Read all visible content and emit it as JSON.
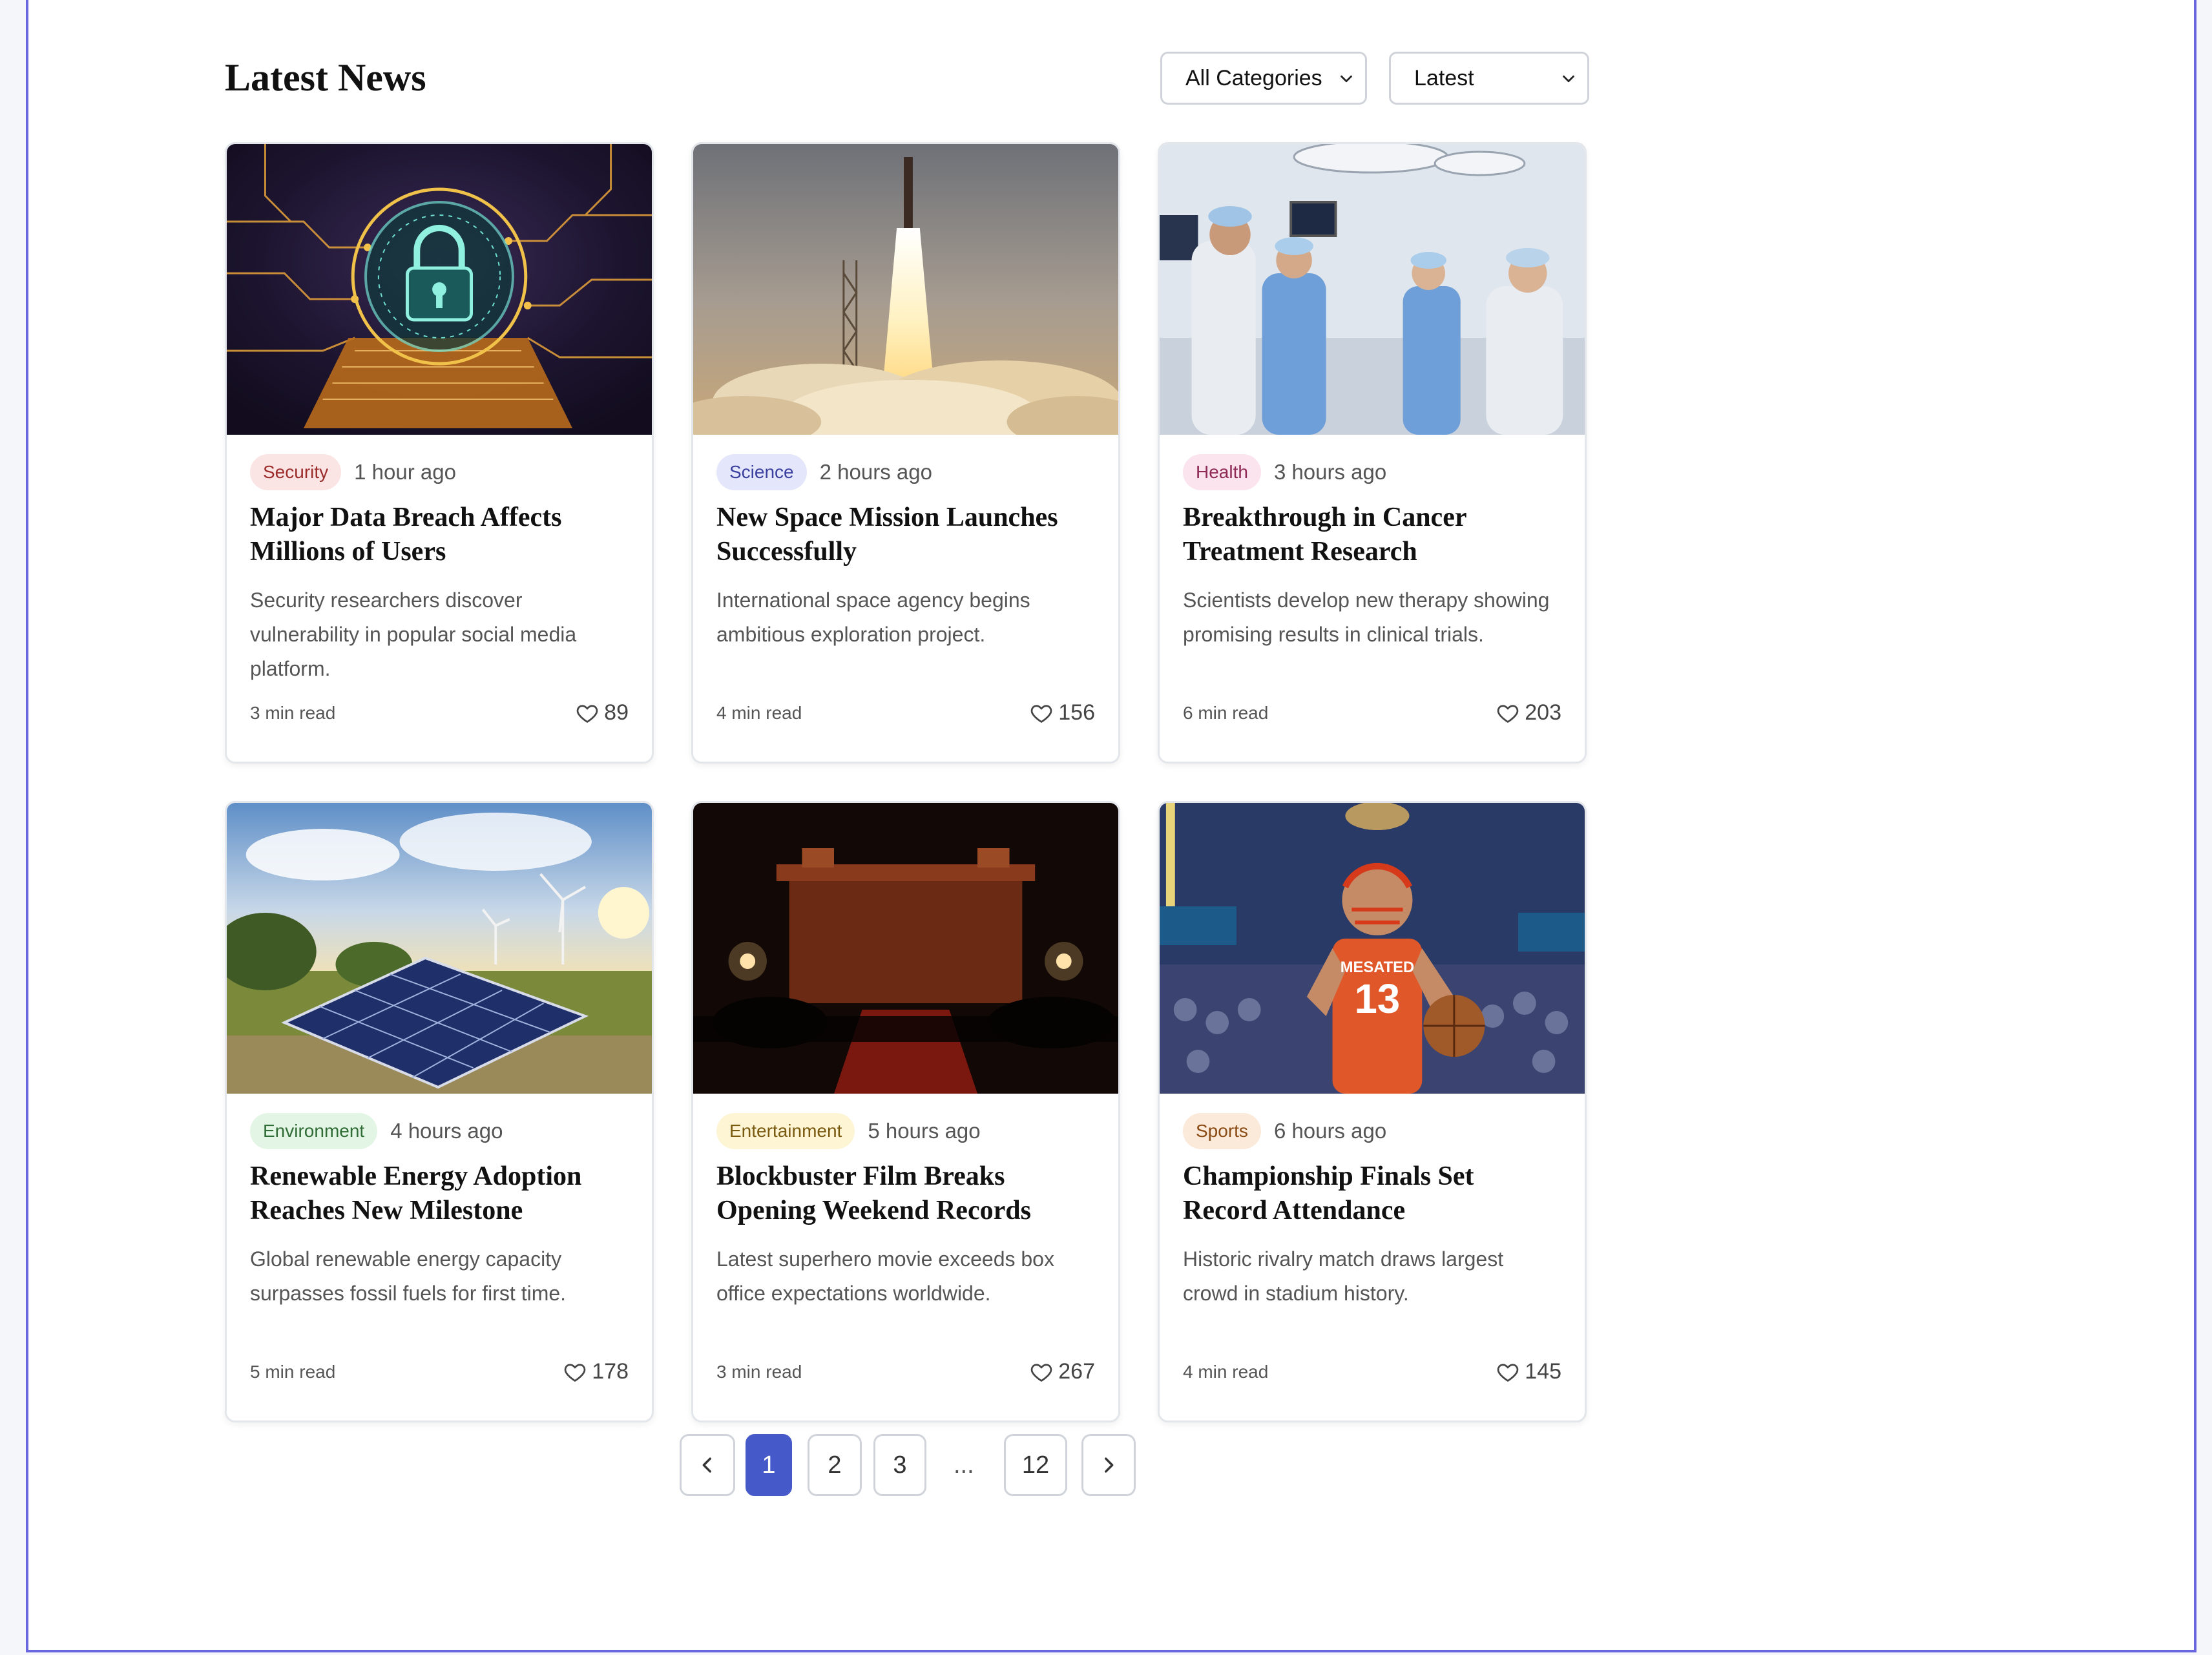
{
  "header": {
    "title": "Latest News",
    "category_select": {
      "value": "All Categories",
      "icon": "chevron-down-icon"
    },
    "sort_select": {
      "value": "Latest",
      "icon": "chevron-down-icon"
    }
  },
  "articles": [
    {
      "category": "Security",
      "badge_bg": "#fbe4e4",
      "badge_fg": "#9b2c2c",
      "time": "1 hour ago",
      "title": "Major Data Breach Affects Millions of Users",
      "excerpt": "Security researchers discover vulnerability in popular social media platform.",
      "read_time": "3 min read",
      "likes": "89"
    },
    {
      "category": "Science",
      "badge_bg": "#e4e6fb",
      "badge_fg": "#3a3f9e",
      "time": "2 hours ago",
      "title": "New Space Mission Launches Successfully",
      "excerpt": "International space agency begins ambitious exploration project.",
      "read_time": "4 min read",
      "likes": "156"
    },
    {
      "category": "Health",
      "badge_bg": "#fbe4ee",
      "badge_fg": "#8e2a55",
      "time": "3 hours ago",
      "title": "Breakthrough in Cancer Treatment Research",
      "excerpt": "Scientists develop new therapy showing promising results in clinical trials.",
      "read_time": "6 min read",
      "likes": "203"
    },
    {
      "category": "Environment",
      "badge_bg": "#e3f5e4",
      "badge_fg": "#2e6b35",
      "time": "4 hours ago",
      "title": "Renewable Energy Adoption Reaches New Milestone",
      "excerpt": "Global renewable energy capacity surpasses fossil fuels for first time.",
      "read_time": "5 min read",
      "likes": "178"
    },
    {
      "category": "Entertainment",
      "badge_bg": "#fdf5d4",
      "badge_fg": "#7a5a10",
      "time": "5 hours ago",
      "title": "Blockbuster Film Breaks Opening Weekend Records",
      "excerpt": "Latest superhero movie exceeds box office expectations worldwide.",
      "read_time": "3 min read",
      "likes": "267"
    },
    {
      "category": "Sports",
      "badge_bg": "#fbeada",
      "badge_fg": "#8a4a14",
      "time": "6 hours ago",
      "title": "Championship Finals Set Record Attendance",
      "excerpt": "Historic rivalry match draws largest crowd in stadium history.",
      "read_time": "4 min read",
      "likes": "145"
    }
  ],
  "image_text": {
    "jersey_name": "MESATED",
    "jersey_number": "13"
  },
  "pagination": {
    "prev_icon": "chevron-left-icon",
    "pages": [
      "1",
      "2",
      "3"
    ],
    "ellipsis": "...",
    "last": "12",
    "next_icon": "chevron-right-icon",
    "current": "1"
  },
  "colors": {
    "accent": "#4659c9",
    "frame_border": "#6a66e0"
  }
}
